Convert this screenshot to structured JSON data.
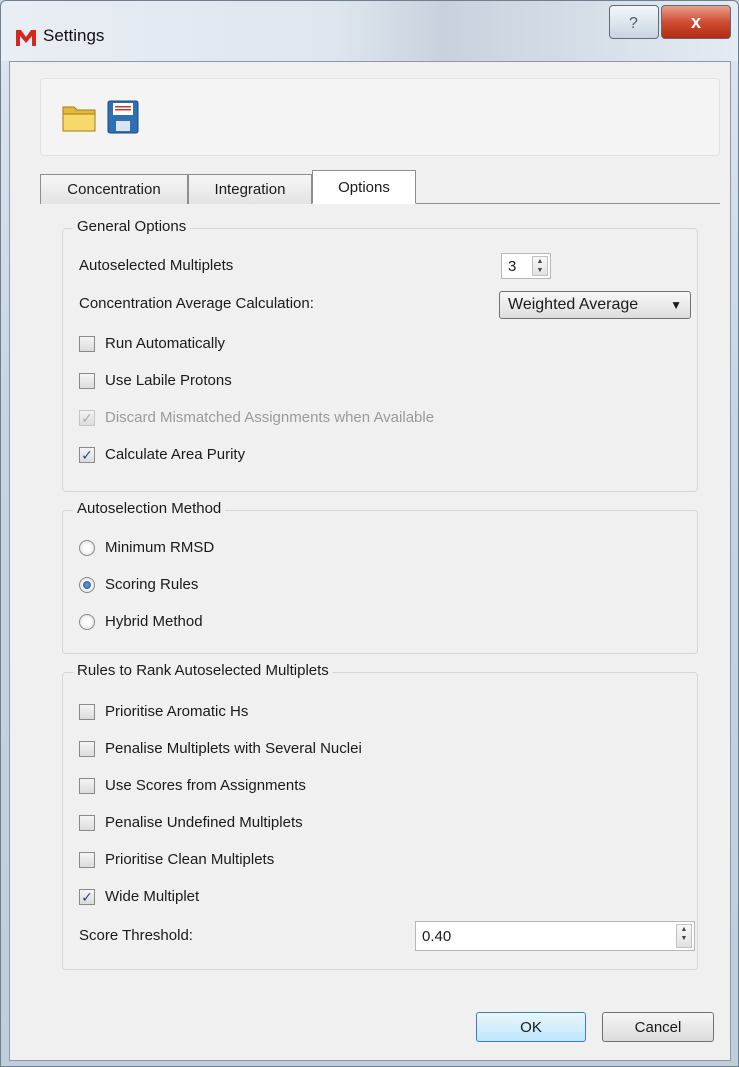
{
  "window": {
    "title": "Settings",
    "help_icon": "help-icon",
    "close_label": "x"
  },
  "toolbar": {
    "open_icon": "folder-icon",
    "save_icon": "save-icon"
  },
  "tabs": [
    {
      "label": "Concentration",
      "active": false
    },
    {
      "label": "Integration",
      "active": false
    },
    {
      "label": "Options",
      "active": true
    }
  ],
  "general": {
    "title": "General Options",
    "autoselected_label": "Autoselected Multiplets",
    "autoselected_value": "3",
    "conc_avg_label": "Concentration Average Calculation:",
    "conc_avg_value": "Weighted Average",
    "run_auto": {
      "label": "Run Automatically",
      "checked": false
    },
    "labile": {
      "label": "Use Labile Protons",
      "checked": false
    },
    "discard": {
      "label": "Discard Mismatched Assignments when Available",
      "checked": true,
      "disabled": true
    },
    "purity": {
      "label": "Calculate Area Purity",
      "checked": true
    }
  },
  "method": {
    "title": "Autoselection Method",
    "options": [
      {
        "label": "Minimum RMSD",
        "selected": false
      },
      {
        "label": "Scoring Rules",
        "selected": true
      },
      {
        "label": "Hybrid Method",
        "selected": false
      }
    ]
  },
  "rules": {
    "title": "Rules to Rank Autoselected Multiplets",
    "items": [
      {
        "label": "Prioritise Aromatic Hs",
        "checked": false
      },
      {
        "label": "Penalise Multiplets with Several Nuclei",
        "checked": false
      },
      {
        "label": "Use Scores from Assignments",
        "checked": false
      },
      {
        "label": "Penalise Undefined Multiplets",
        "checked": false
      },
      {
        "label": "Prioritise Clean Multiplets",
        "checked": false
      },
      {
        "label": "Wide Multiplet",
        "checked": true
      }
    ],
    "threshold_label": "Score Threshold:",
    "threshold_value": "0.40"
  },
  "buttons": {
    "ok": "OK",
    "cancel": "Cancel"
  },
  "colors": {
    "accent": "#3c7fb1",
    "close_red": "#c8402a"
  }
}
